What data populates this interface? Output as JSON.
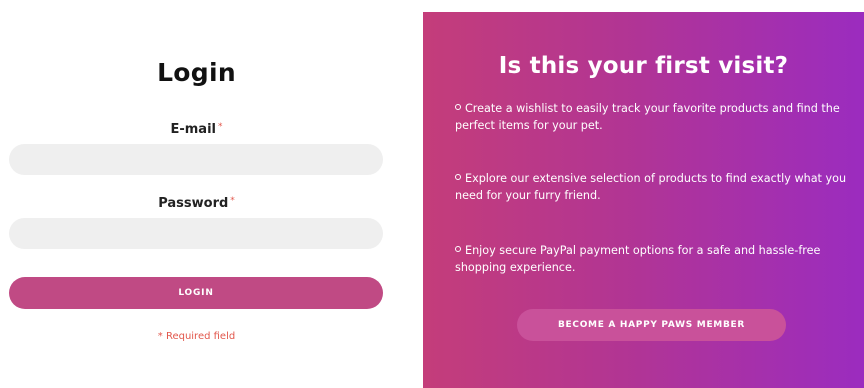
{
  "login": {
    "title": "Login",
    "email_label": "E-mail",
    "password_label": "Password",
    "required_marker": "*",
    "email_value": "",
    "password_value": "",
    "button_label": "LOGIN",
    "required_note": "* Required field"
  },
  "promo": {
    "title": "Is this your first visit?",
    "bullets": [
      "Create a wishlist to easily track your favorite products and find the perfect items for your pet.",
      "Explore our extensive selection of products to find exactly what you need for your furry friend.",
      "Enjoy secure PayPal payment options for a safe and hassle-free shopping experience."
    ],
    "button_label": "BECOME A HAPPY PAWS MEMBER"
  },
  "colors": {
    "accent": "#c04a84",
    "gradient_start": "#c43d7a",
    "gradient_end": "#9b2cbf",
    "required": "#e2574c",
    "input_bg": "#efefef"
  },
  "icons": {
    "bullet": "circle-bullet-icon"
  }
}
